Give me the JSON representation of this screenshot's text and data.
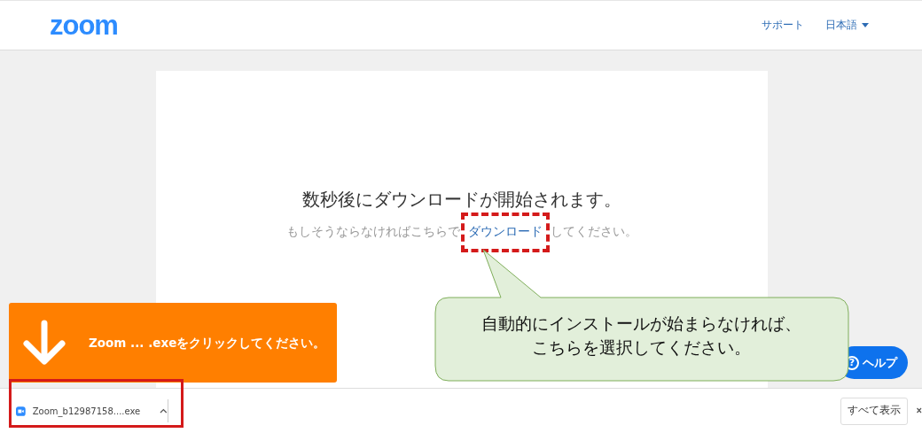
{
  "header": {
    "logo": "zoom",
    "links": [
      {
        "label": "サポート",
        "dropdown": false
      },
      {
        "label": "日本語",
        "dropdown": true
      }
    ]
  },
  "message": {
    "title": "数秒後にダウンロードが開始されます。",
    "subtitle_before": "もしそうならなければこちらで",
    "link": "ダウンロード",
    "subtitle_after": "してください。"
  },
  "help_button": {
    "icon": "?",
    "label": "ヘルプ"
  },
  "banner": {
    "text": "Zoom ... .exeをクリックしてください。"
  },
  "callout": {
    "lines": [
      "自動的にインストールが始まらなければ、",
      "こちらを選択してください。"
    ]
  },
  "download_bar": {
    "items": [
      {
        "filename": "Zoom_b12987158....exe"
      }
    ],
    "show_all": "すべて表示"
  },
  "annotations": [
    {
      "kind": "dashed"
    },
    {
      "kind": "solid"
    }
  ]
}
